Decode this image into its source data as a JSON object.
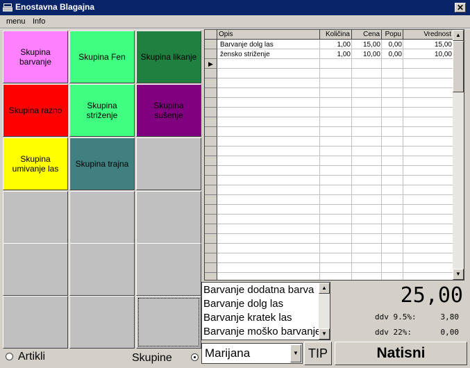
{
  "window": {
    "title": "Enostavna Blagajna",
    "close_glyph": "✕"
  },
  "menu": {
    "items": [
      "menu",
      "Info"
    ]
  },
  "groups": [
    {
      "label": "Skupina barvanje",
      "color": "#ff80ff"
    },
    {
      "label": "Skupina Fen",
      "color": "#40ff80"
    },
    {
      "label": "Skupina likanje",
      "color": "#208040"
    },
    {
      "label": "Skupina razno",
      "color": "#ff0000"
    },
    {
      "label": "Skupina striženje",
      "color": "#40ff80"
    },
    {
      "label": "Skupina sušenje",
      "color": "#800080"
    },
    {
      "label": "Skupina umivanje las",
      "color": "#ffff00"
    },
    {
      "label": "Skupina trajna",
      "color": "#408080"
    }
  ],
  "mode": {
    "artikli_label": "Artikli",
    "skupine_label": "Skupine",
    "selected": "Skupine"
  },
  "table": {
    "columns": [
      "Opis",
      "Količina",
      "Cena",
      "Popu",
      "Vrednost"
    ],
    "rows": [
      [
        "Barvanje dolg las",
        "1,00",
        "15,00",
        "0,00",
        "15,00"
      ],
      [
        "žensko striženje",
        "1,00",
        "10,00",
        "0,00",
        "10,00"
      ]
    ],
    "pointer_glyph": "▶"
  },
  "article_list": {
    "items": [
      "Barvanje dodatna barva",
      "Barvanje dolg las",
      "Barvanje kratek las",
      "Barvanje moško barvanje"
    ]
  },
  "totals": {
    "total": "25,00",
    "ddv_lines": [
      {
        "label": "ddv 9.5%:",
        "value": "3,80"
      },
      {
        "label": "ddv  22%:",
        "value": "0,00"
      }
    ]
  },
  "staff": {
    "selected": "Marijana"
  },
  "buttons": {
    "tip": "TIP",
    "print": "Natisni"
  },
  "icons": {
    "scroll_up": "▲",
    "scroll_down": "▼",
    "dropdown": "▼"
  }
}
